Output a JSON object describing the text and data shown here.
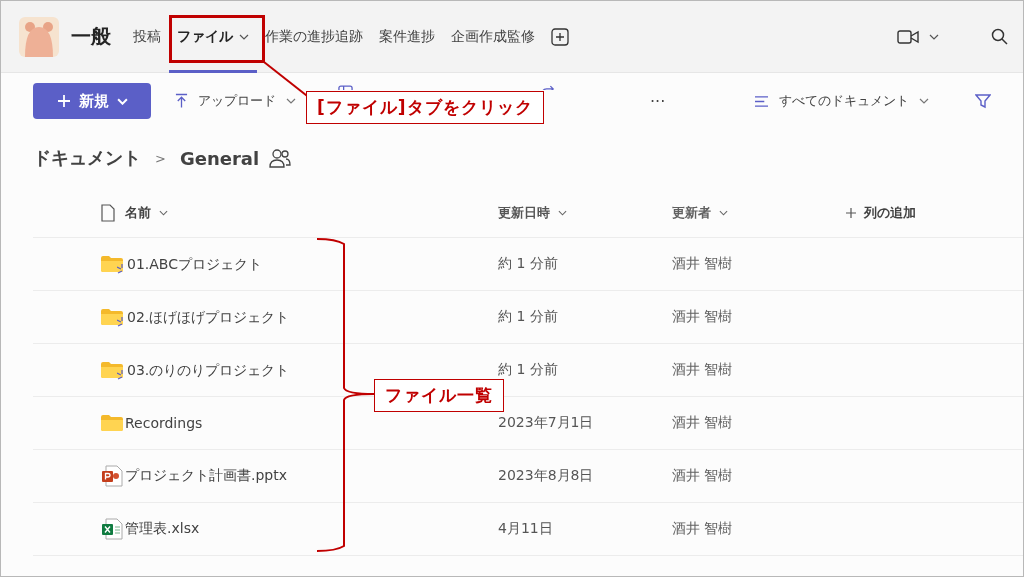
{
  "header": {
    "title": "一般",
    "tabs": [
      {
        "label": "投稿",
        "selected": false,
        "dropdown": false
      },
      {
        "label": "ファイル",
        "selected": true,
        "dropdown": true
      },
      {
        "label": "作業の進捗追跡",
        "selected": false,
        "dropdown": false
      },
      {
        "label": "案件進捗",
        "selected": false,
        "dropdown": false
      },
      {
        "label": "企画作成監修",
        "selected": false,
        "dropdown": false
      }
    ]
  },
  "toolbar": {
    "new_button": "新規",
    "upload": "アップロード",
    "more": "···",
    "view": "すべてのドキュメント"
  },
  "breadcrumb": {
    "root": "ドキュメント",
    "separator": ">",
    "current": "General"
  },
  "table": {
    "columns": [
      "名前",
      "更新日時",
      "更新者"
    ],
    "add_column": "列の追加",
    "rows": [
      {
        "kind": "folder",
        "new": true,
        "name": "01.ABCプロジェクト",
        "modified": "約 1 分前",
        "modified_by": "酒井 智樹"
      },
      {
        "kind": "folder",
        "new": true,
        "name": "02.ほげほげプロジェクト",
        "modified": "約 1 分前",
        "modified_by": "酒井 智樹"
      },
      {
        "kind": "folder",
        "new": true,
        "name": "03.のりのりプロジェクト",
        "modified": "約 1 分前",
        "modified_by": "酒井 智樹"
      },
      {
        "kind": "folder",
        "new": false,
        "name": "Recordings",
        "modified": "2023年7月1日",
        "modified_by": "酒井 智樹"
      },
      {
        "kind": "pptx",
        "new": false,
        "name": "プロジェクト計画書.pptx",
        "modified": "2023年8月8日",
        "modified_by": "酒井 智樹"
      },
      {
        "kind": "xlsx",
        "new": false,
        "name": "管理表.xlsx",
        "modified": "4月11日",
        "modified_by": "酒井 智樹"
      }
    ]
  },
  "annotations": [
    {
      "kind": "tab_callout",
      "text": "[ファイル]タブをクリック"
    },
    {
      "kind": "list_brace",
      "text": "ファイル一覧"
    }
  ]
}
